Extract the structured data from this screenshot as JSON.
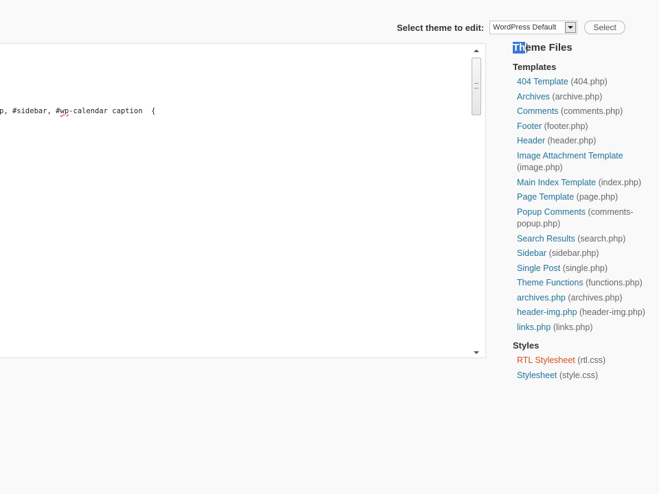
{
  "theme_selector": {
    "label": "Select theme to edit:",
    "selected_theme": "WordPress Default",
    "button_label": "Select"
  },
  "editor": {
    "code_before_flag": "p, #sidebar, #",
    "code_flag": "wp",
    "code_after_flag": "-calendar caption  {"
  },
  "sidebar": {
    "title_selected": "Th",
    "title_rest": "eme Files",
    "templates_heading": "Templates",
    "templates": [
      {
        "link": "404 Template",
        "file": "(404.php)"
      },
      {
        "link": "Archives",
        "file": "(archive.php)"
      },
      {
        "link": "Comments",
        "file": "(comments.php)"
      },
      {
        "link": "Footer",
        "file": "(footer.php)"
      },
      {
        "link": "Header",
        "file": "(header.php)"
      },
      {
        "link": "Image Attachment Template",
        "file": "(image.php)"
      },
      {
        "link": "Main Index Template",
        "file": "(index.php)"
      },
      {
        "link": "Page Template",
        "file": "(page.php)"
      },
      {
        "link": "Popup Comments",
        "file": "(comments-popup.php)"
      },
      {
        "link": "Search Results",
        "file": "(search.php)"
      },
      {
        "link": "Sidebar",
        "file": "(sidebar.php)"
      },
      {
        "link": "Single Post",
        "file": "(single.php)"
      },
      {
        "link": "Theme Functions",
        "file": "(functions.php)"
      },
      {
        "link": "archives.php",
        "file": "(archives.php)"
      },
      {
        "link": "header-img.php",
        "file": "(header-img.php)"
      },
      {
        "link": "links.php",
        "file": "(links.php)"
      }
    ],
    "styles_heading": "Styles",
    "styles": [
      {
        "link": "RTL Stylesheet",
        "file": "(rtl.css)"
      },
      {
        "link": "Stylesheet",
        "file": "(style.css)"
      }
    ],
    "active_color": "#d54e21",
    "link_color": "#21759b"
  }
}
